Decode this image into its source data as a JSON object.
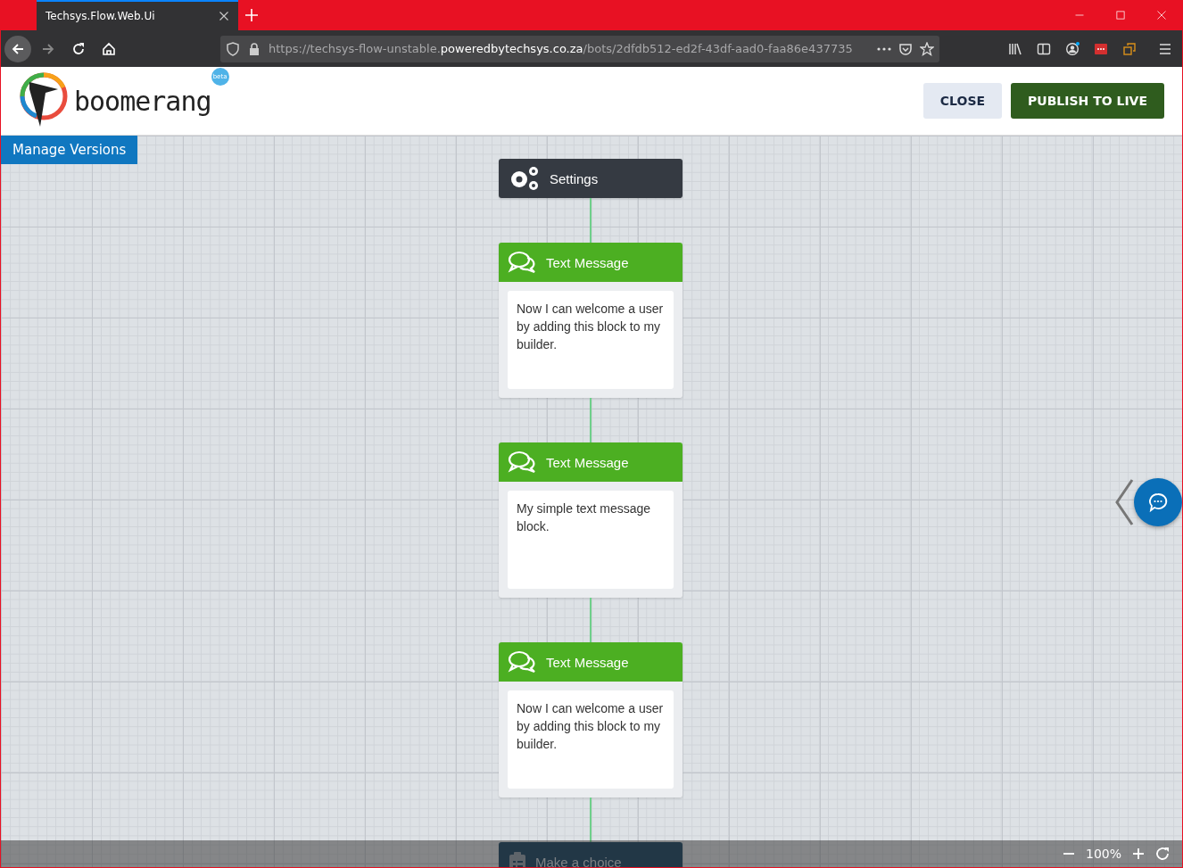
{
  "browser": {
    "tab": {
      "title": "Techsys.Flow.Web.Ui",
      "selected": true
    },
    "url": {
      "prefix": "https://techsys-flow-unstable.",
      "domain": "poweredbytechsys.co.za",
      "path": "/bots/2dfdb512-ed2f-43df-aad0-faa86e437735"
    }
  },
  "header": {
    "logo_text": "boomerang",
    "badge": "beta",
    "buttons": [
      {
        "label": "CLOSE",
        "kind": "secondary"
      },
      {
        "label": "PUBLISH TO LIVE",
        "kind": "primary"
      }
    ]
  },
  "manage_versions": "Manage Versions",
  "nodes": [
    {
      "kind": "settings",
      "title": "Settings"
    },
    {
      "kind": "text",
      "title": "Text Message",
      "body": "Now I can welcome a user by adding this block to my builder."
    },
    {
      "kind": "text",
      "title": "Text Message",
      "body": "My simple text message block."
    },
    {
      "kind": "text",
      "title": "Text Message",
      "body": "Now I can welcome a user by adding this block to my builder."
    },
    {
      "kind": "choice",
      "title": "Make a choice"
    }
  ],
  "zoom": {
    "reading": "100%"
  }
}
